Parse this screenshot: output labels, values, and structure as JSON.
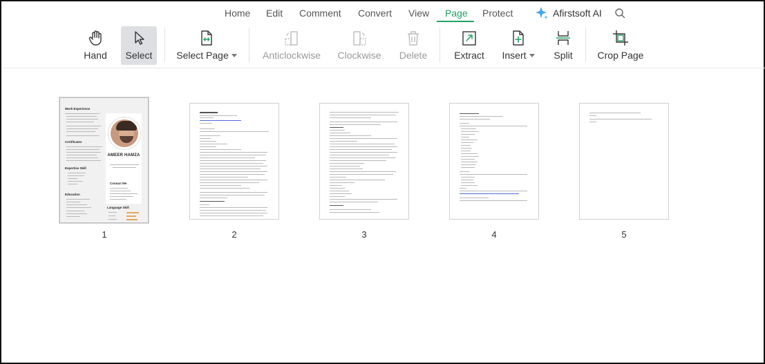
{
  "menu": {
    "items": [
      "Home",
      "Edit",
      "Comment",
      "Convert",
      "View",
      "Page",
      "Protect"
    ],
    "active": "Page",
    "ai_label": "Afirstsoft AI"
  },
  "toolbar": {
    "hand": "Hand",
    "select": "Select",
    "select_page": "Select Page",
    "anticlockwise": "Anticlockwise",
    "clockwise": "Clockwise",
    "delete": "Delete",
    "extract": "Extract",
    "insert": "Insert",
    "split": "Split",
    "crop_page": "Crop Page"
  },
  "colors": {
    "accent": "#21a163",
    "ai_icon": "#3ba7e8",
    "selected_tool_bg": "#dedfe2",
    "disabled_text": "#9a9a9a"
  },
  "thumbnails": {
    "numbers": [
      "1",
      "2",
      "3",
      "4",
      "5"
    ],
    "selected": "1",
    "resume": {
      "name": "AMEER HAMZA",
      "sections": [
        "Work Experience",
        "Certificates",
        "Expertise Skill",
        "Education",
        "Contact Me",
        "Language Skill"
      ]
    }
  }
}
